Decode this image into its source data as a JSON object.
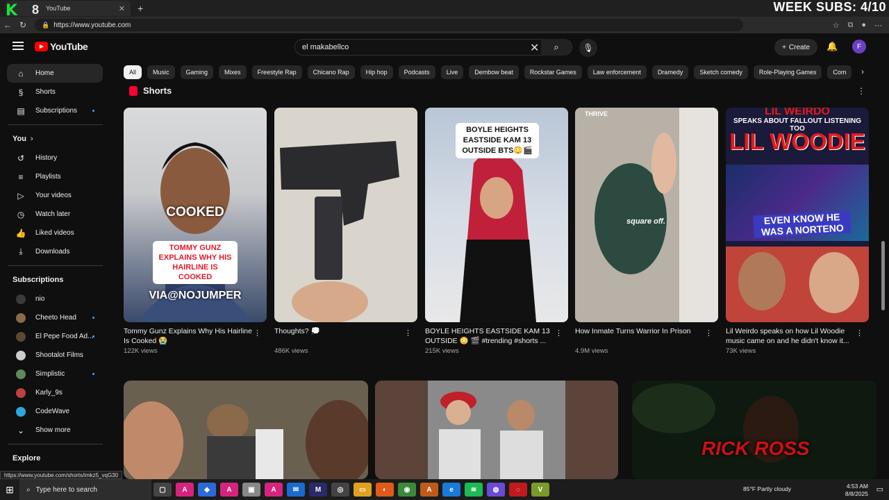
{
  "browser": {
    "tab_title": "YouTube",
    "url": "https://www.youtube.com"
  },
  "overlays": {
    "logo_letter": "K",
    "counter": "8",
    "subs": "WEEK SUBS: 4/10"
  },
  "header": {
    "logo_text": "YouTube",
    "search_value": "el makabellco",
    "create_label": "Create",
    "avatar_letter": "F"
  },
  "sidebar": {
    "main": [
      {
        "label": "Home",
        "icon": "home-icon"
      },
      {
        "label": "Shorts",
        "icon": "shorts-icon"
      },
      {
        "label": "Subscriptions",
        "icon": "subscriptions-icon"
      }
    ],
    "you_header": "You",
    "you": [
      {
        "label": "History",
        "icon": "history-icon"
      },
      {
        "label": "Playlists",
        "icon": "playlists-icon"
      },
      {
        "label": "Your videos",
        "icon": "your-videos-icon"
      },
      {
        "label": "Watch later",
        "icon": "watch-later-icon"
      },
      {
        "label": "Liked videos",
        "icon": "like-icon"
      },
      {
        "label": "Downloads",
        "icon": "download-icon"
      }
    ],
    "subs_header": "Subscriptions",
    "subs": [
      {
        "label": "nio",
        "color": "#3a3a3a"
      },
      {
        "label": "Cheeto Head",
        "color": "#8a6a4a"
      },
      {
        "label": "El Pepe Food Ad...",
        "color": "#5a4a30"
      },
      {
        "label": "Shootalot Films",
        "color": "#cccccc"
      },
      {
        "label": "Simplistic",
        "color": "#5c8a5c"
      },
      {
        "label": "Karly_9s",
        "color": "#c04040"
      },
      {
        "label": "CodeWave",
        "color": "#2aa8e0"
      }
    ],
    "show_more": "Show more",
    "explore_header": "Explore"
  },
  "chips": [
    "All",
    "Music",
    "Gaming",
    "Mixes",
    "Freestyle Rap",
    "Chicano Rap",
    "Hip hop",
    "Podcasts",
    "Live",
    "Dembow beat",
    "Rockstar Games",
    "Law enforcement",
    "Dramedy",
    "Sketch comedy",
    "Role-Playing Games",
    "Com"
  ],
  "shorts_header": "Shorts",
  "shorts": [
    {
      "title": "Tommy Gunz Explains Why His Hairline Is Cooked 😭",
      "views": "122K views",
      "overlay_top": "COOKED",
      "overlay_mid": "TOMMY GUNZ EXPLAINS WHY HIS HAIRLINE IS COOKED",
      "overlay_bottom": "VIA@NOJUMPER"
    },
    {
      "title": "Thoughts? 💭",
      "views": "486K views"
    },
    {
      "title": "BOYLE HEIGHTS EASTSIDE KAM 13 OUTSIDE 😳 🎬 #trending #shorts ...",
      "views": "215K views",
      "overlay_top": "BOYLE HEIGHTS EASTSIDE KAM 13 OUTSIDE BTS😳🎬"
    },
    {
      "title": "How Inmate Turns Warrior In Prison",
      "views": "4.9M views",
      "overlay_top": "THRIVE",
      "overlay_mid": "square off."
    },
    {
      "title": "Lil Weirdo speaks on how Lil Woodie music came on and he didn't know it...",
      "views": "73K views",
      "overlay_top": "LIL WEIRDO",
      "overlay_mid": "SPEAKS ABOUT FALLOUT LISTENING TOO",
      "overlay_big": "LIL WOODIE",
      "overlay_bottom": "EVEN KNOW HE WAS A NORTENO"
    }
  ],
  "big_video_overlay": "RICK ROSS",
  "status_url": "https://www.youtube.com/shorts/imkz5_vqG30",
  "taskbar": {
    "search_placeholder": "Type here to search",
    "weather": "85°F  Partly cloudy",
    "time": "4:53 AM",
    "date": "8/8/2025"
  }
}
